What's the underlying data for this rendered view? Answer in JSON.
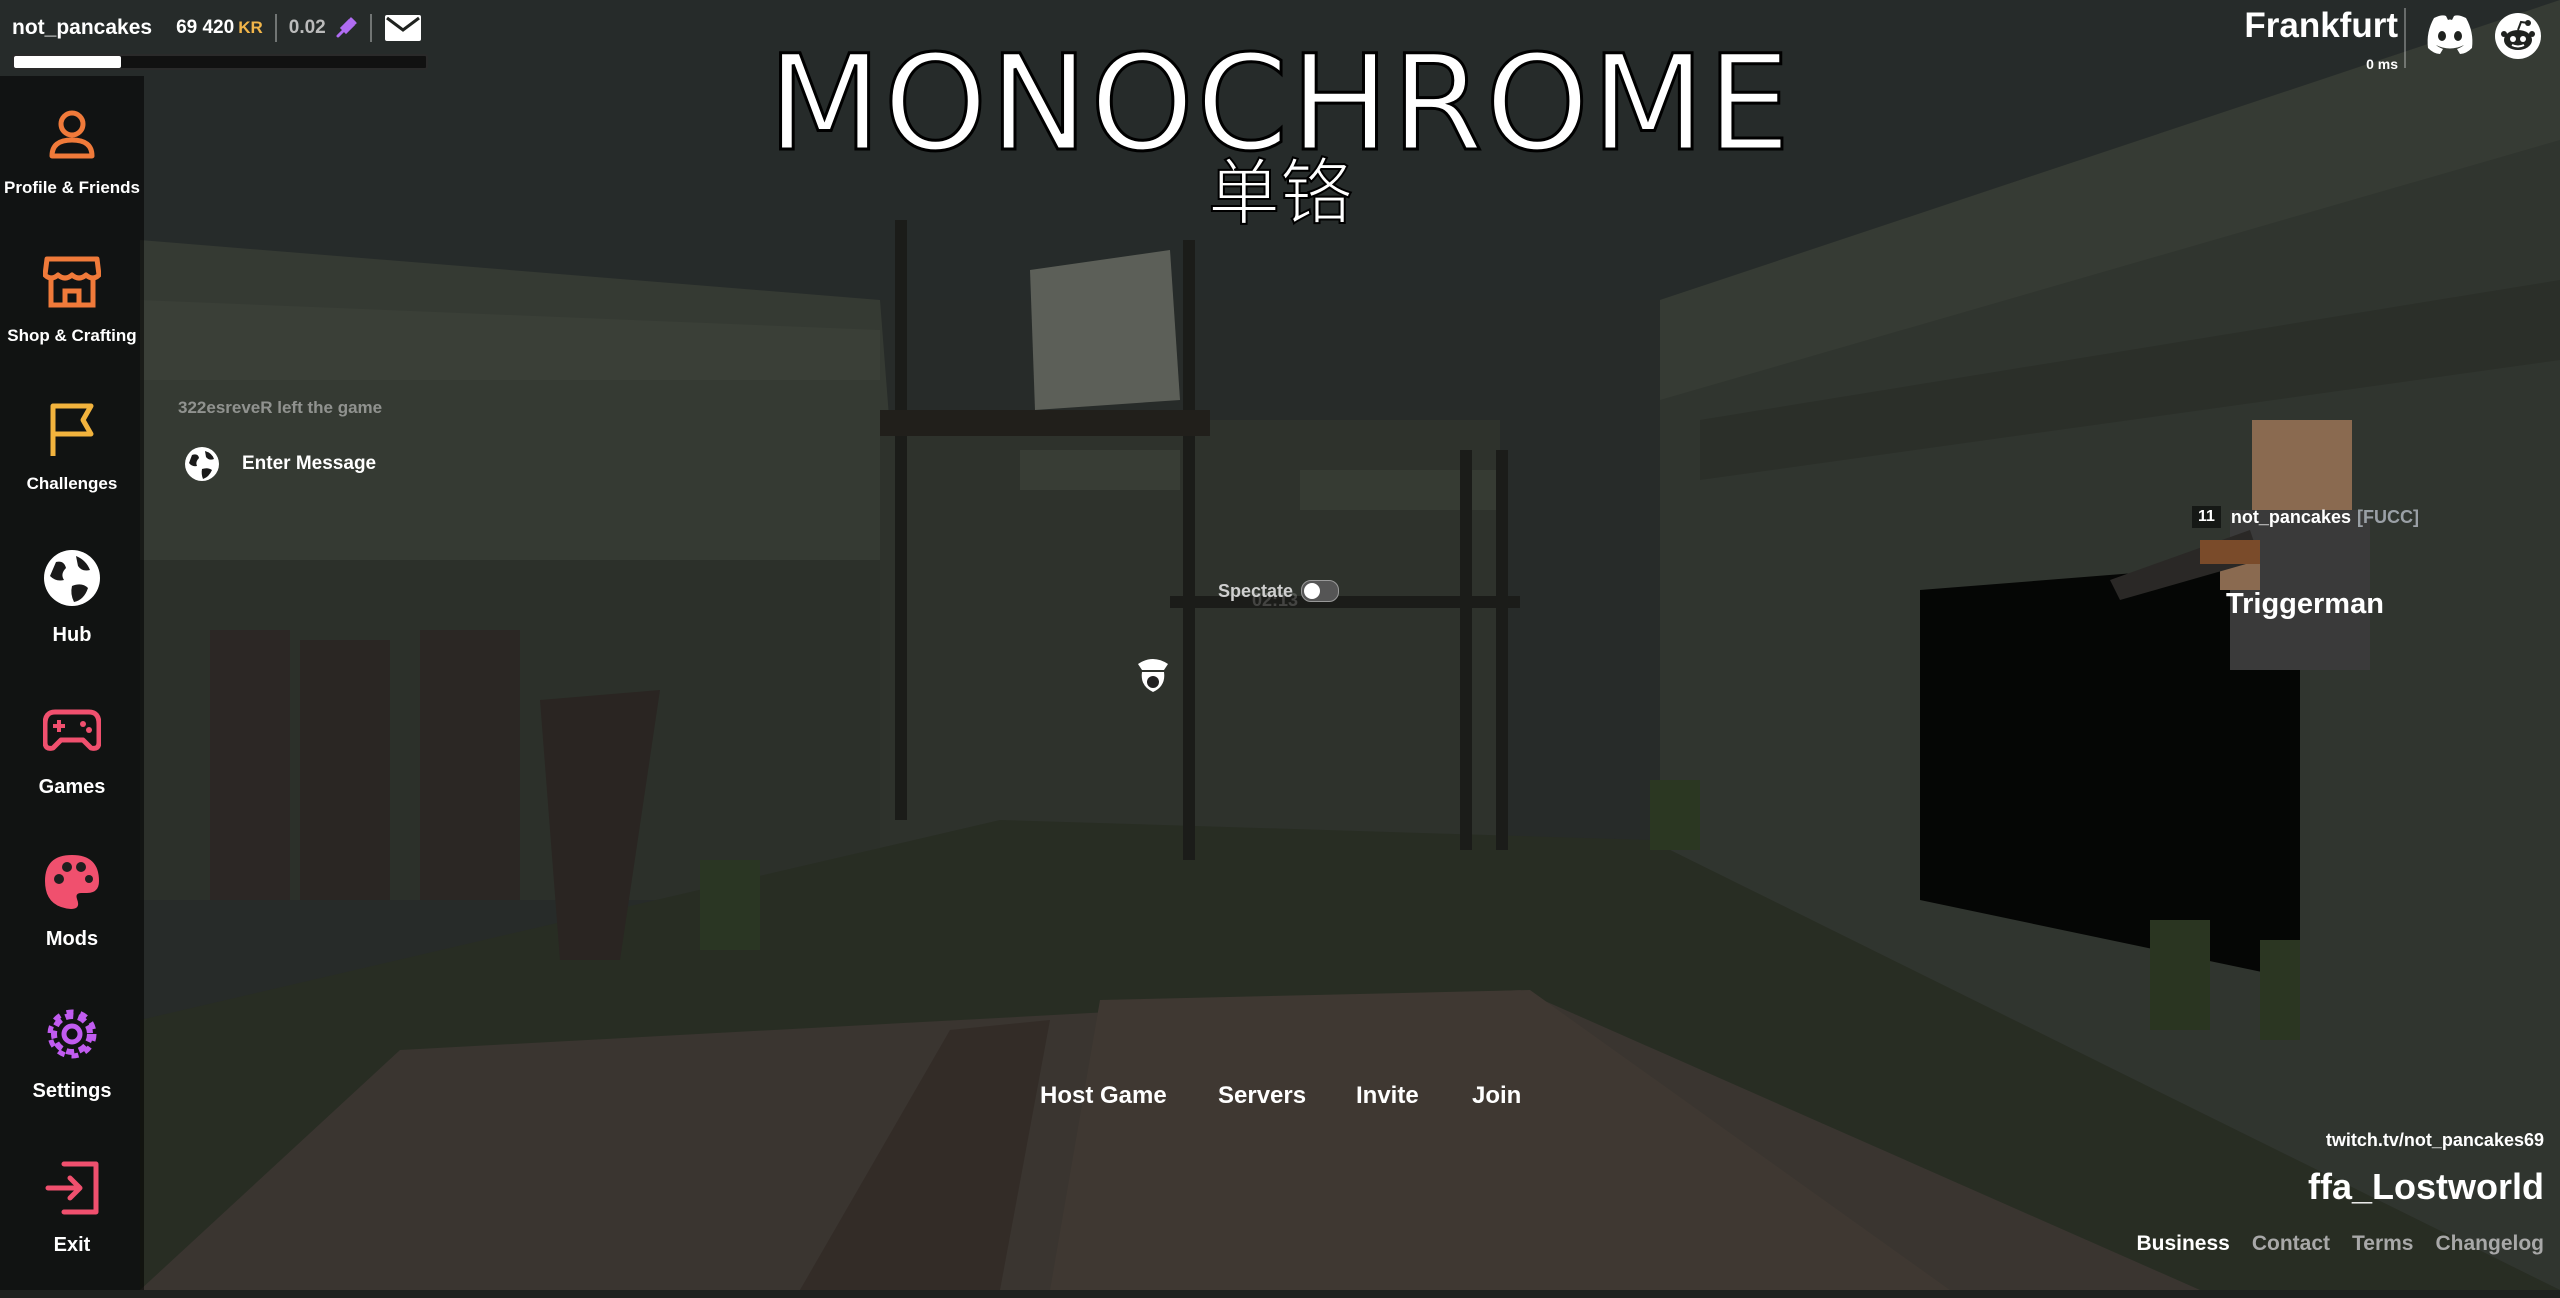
{
  "player": {
    "username": "not_pancakes",
    "kr": "69 420",
    "kr_unit": "KR",
    "kr2": "0.02",
    "level_progress": 0.26
  },
  "mode_title": "MONOCHROME",
  "mode_subtitle": "单铬",
  "sidebar": {
    "items": [
      {
        "label": "Profile & Friends",
        "icon": "profile-icon",
        "color": "#f07a3a"
      },
      {
        "label": "Shop & Crafting",
        "icon": "shop-icon",
        "color": "#f07a3a"
      },
      {
        "label": "Challenges",
        "icon": "flag-icon",
        "color": "#f2b33d"
      },
      {
        "label": "Hub",
        "icon": "globe-icon",
        "color": "#ffffff"
      },
      {
        "label": "Games",
        "icon": "gamepad-icon",
        "color": "#f0506e"
      },
      {
        "label": "Mods",
        "icon": "palette-icon",
        "color": "#f0506e"
      },
      {
        "label": "Settings",
        "icon": "gear-icon",
        "color": "#c15cf0"
      },
      {
        "label": "Exit",
        "icon": "exit-icon",
        "color": "#f0506e"
      }
    ]
  },
  "chat": {
    "last_message": "322esreveR left the game",
    "input_placeholder": "Enter Message"
  },
  "spectate": {
    "label": "Spectate",
    "enabled": false
  },
  "round_timer": "02:13",
  "menu": {
    "host": "Host Game",
    "servers": "Servers",
    "invite": "Invite",
    "join": "Join"
  },
  "server": {
    "region": "Frankfurt",
    "ping": "0 ms"
  },
  "preview_player": {
    "level": "11",
    "name": "not_pancakes",
    "clan": "[FUCC]",
    "class": "Triggerman"
  },
  "twitch": "twitch.tv/not_pancakes69",
  "map_name": "ffa_Lostworld",
  "footer": {
    "business": "Business",
    "contact": "Contact",
    "terms": "Terms",
    "changelog": "Changelog"
  }
}
